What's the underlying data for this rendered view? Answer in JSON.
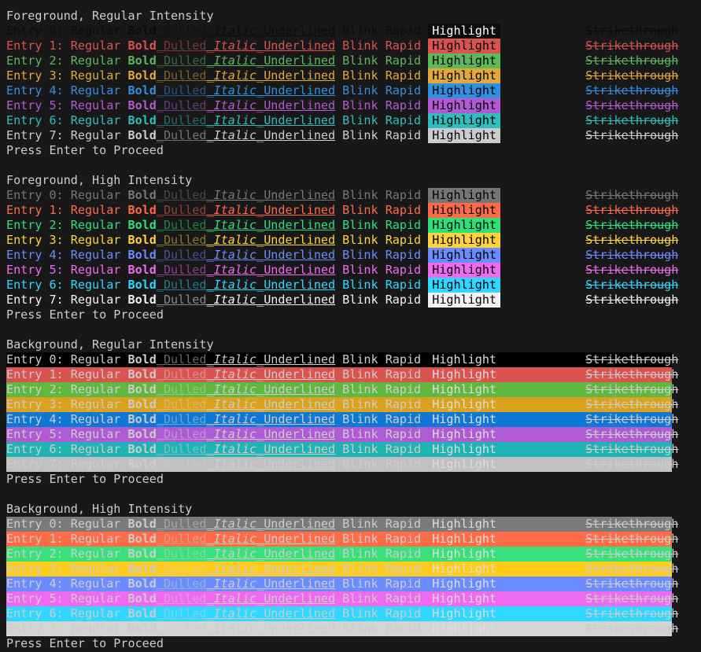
{
  "palette": {
    "regular": [
      "#0c0c0c",
      "#c50f1f",
      "#13a10e",
      "#c19c00",
      "#0037da",
      "#881798",
      "#3a96dd",
      "#cccccc"
    ],
    "high": [
      "#767676",
      "#e74856",
      "#16c60c",
      "#f9f1a5",
      "#3b78ff",
      "#b4009e",
      "#61d6d6",
      "#f2f2f2"
    ],
    "fg_regular": [
      "#0c0c0c",
      "#d9534f",
      "#5cb85c",
      "#e0a93a",
      "#2f8fe0",
      "#b25ad3",
      "#2fbdbd",
      "#cccccc"
    ],
    "fg_high": [
      "#767676",
      "#ff6a47",
      "#2ee07a",
      "#ffd43a",
      "#6a8cff",
      "#f06af0",
      "#30d8ff",
      "#f2f2f2"
    ],
    "bg_regular": [
      "#000000",
      "#d9534f",
      "#60b840",
      "#dba21d",
      "#0f78d6",
      "#b05bd3",
      "#1fb3b3",
      "#c0c0c0"
    ],
    "bg_high": [
      "#7a7a7a",
      "#ff6a47",
      "#3ae07a",
      "#ffcc1a",
      "#6a8cff",
      "#f06af0",
      "#30d8ff",
      "#d4d4d4"
    ],
    "console_fg": "#cccccc",
    "console_bg": "#181818"
  },
  "labels": {
    "entry_prefix": "Entry ",
    "regular": "Regular",
    "bold": "Bold",
    "dulled": "Dulled",
    "italic": "Italic",
    "underlined": "Underlined",
    "blink": "Blink",
    "rapid": "Rapid",
    "highlight": "Highlight",
    "strikethrough": "Strikethrough",
    "press_enter": "Press Enter to Proceed"
  },
  "sections": [
    {
      "title": "Foreground, Regular Intensity",
      "mode": "fg",
      "intensity": "regular",
      "entries": [
        0,
        1,
        2,
        3,
        4,
        5,
        6,
        7
      ]
    },
    {
      "title": "Foreground, High Intensity",
      "mode": "fg",
      "intensity": "high",
      "entries": [
        0,
        1,
        2,
        3,
        4,
        5,
        6,
        7
      ]
    },
    {
      "title": "Background, Regular Intensity",
      "mode": "bg",
      "intensity": "regular",
      "entries": [
        0,
        1,
        2,
        3,
        4,
        5,
        6,
        7
      ]
    },
    {
      "title": "Background, High Intensity",
      "mode": "bg",
      "intensity": "high",
      "entries": [
        0,
        1,
        2,
        3,
        4,
        5,
        6,
        7
      ]
    }
  ]
}
